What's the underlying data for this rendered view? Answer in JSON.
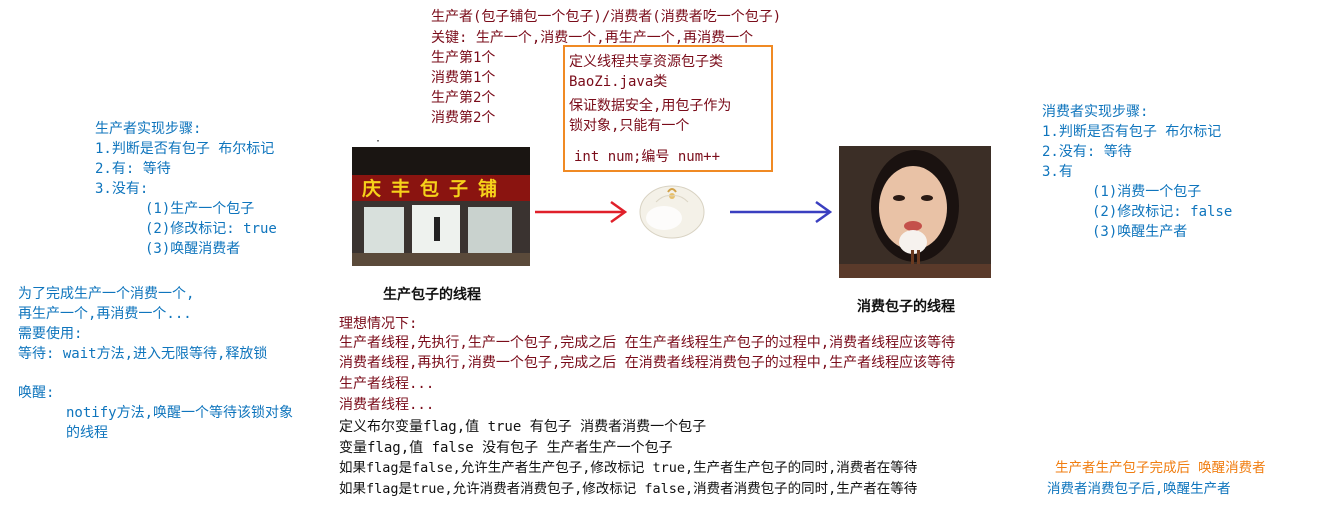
{
  "header": {
    "title": "生产者(包子铺包一个包子)/消费者(消费者吃一个包子)",
    "key": "关键: 生产一个,消费一个,再生产一个,再消费一个",
    "seq": [
      "生产第1个",
      "消费第1个",
      "生产第2个",
      "消费第2个"
    ]
  },
  "resource_box": {
    "line1": "定义线程共享资源包子类",
    "line2": "BaoZi.java类",
    "line3": "保证数据安全,用包子作为",
    "line4": "锁对象,只能有一个",
    "line5": "int num;编号 num++"
  },
  "producer_steps": {
    "title": "生产者实现步骤:",
    "s1": "1.判断是否有包子 布尔标记",
    "s2": "2.有: 等待",
    "s3": "3.没有:",
    "s3a": "(1)生产一个包子",
    "s3b": "(2)修改标记: true",
    "s3c": "(3)唤醒消费者"
  },
  "consumer_steps": {
    "title": "消费者实现步骤:",
    "s1": "1.判断是否有包子 布尔标记",
    "s2": "2.没有: 等待",
    "s3": "3.有",
    "s3a": "(1)消费一个包子",
    "s3b": "(2)修改标记: false",
    "s3c": "(3)唤醒生产者"
  },
  "notes": {
    "n1": "为了完成生产一个消费一个,",
    "n2": "再生产一个,再消费一个...",
    "n3": "需要使用:",
    "n4": "等待: wait方法,进入无限等待,释放锁",
    "n5": "唤醒:",
    "n6": "notify方法,唤醒一个等待该锁对象",
    "n7": "的线程"
  },
  "shop_sign": "庆丰包子铺",
  "producer_label": "生产包子的线程",
  "consumer_label": "消费包子的线程",
  "ideal": {
    "title": "理想情况下:",
    "l1": "生产者线程,先执行,生产一个包子,完成之后 在生产者线程生产包子的过程中,消费者线程应该等待",
    "l2": "消费者线程,再执行,消费一个包子,完成之后 在消费者线程消费包子的过程中,生产者线程应该等待",
    "l3": "生产者线程...",
    "l4": "消费者线程..."
  },
  "flag": {
    "l1": "定义布尔变量flag,值 true 有包子 消费者消费一个包子",
    "l2": "变量flag,值 false 没有包子 生产者生产一个包子",
    "l3": "如果flag是false,允许生产者生产包子,修改标记 true,生产者生产包子的同时,消费者在等待",
    "l3b": "生产者生产包子完成后 唤醒消费者",
    "l4": "如果flag是true,允许消费者消费包子,修改标记 false,消费者消费包子的同时,生产者在等待",
    "l4b": "消费者消费包子后,唤醒生产者"
  },
  "colors": {
    "blue": "#0f75bd",
    "dark_red": "#7a0c1a",
    "orange": "#f07d10",
    "red_arrow": "#e0202a",
    "blue_arrow": "#3a3fc0"
  },
  "icons": [
    "right-arrow-icon",
    "right-arrow-icon"
  ]
}
